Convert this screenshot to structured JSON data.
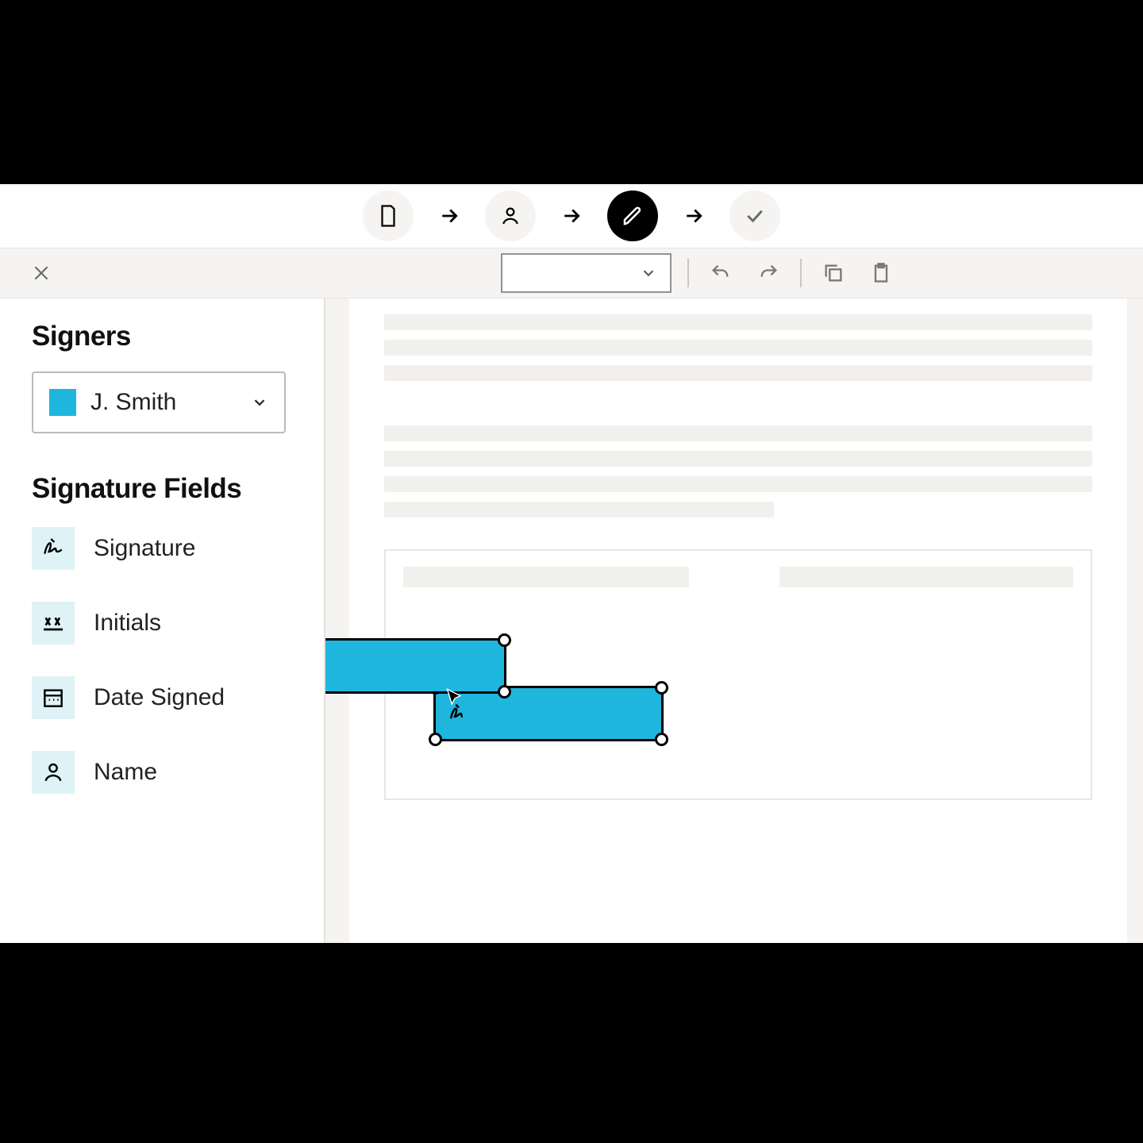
{
  "sidebar": {
    "signers_heading": "Signers",
    "selected_signer": "J. Smith",
    "fields_heading": "Signature Fields",
    "fields": [
      {
        "label": "Signature",
        "icon": "signature-icon"
      },
      {
        "label": "Initials",
        "icon": "initials-icon"
      },
      {
        "label": "Date Signed",
        "icon": "date-icon"
      },
      {
        "label": "Name",
        "icon": "person-icon"
      }
    ]
  },
  "stepper": {
    "steps": [
      "document",
      "signers",
      "edit",
      "review"
    ],
    "active_index": 2
  },
  "toolbar": {
    "zoom_value": ""
  },
  "colors": {
    "signer": "#1fb6de"
  }
}
